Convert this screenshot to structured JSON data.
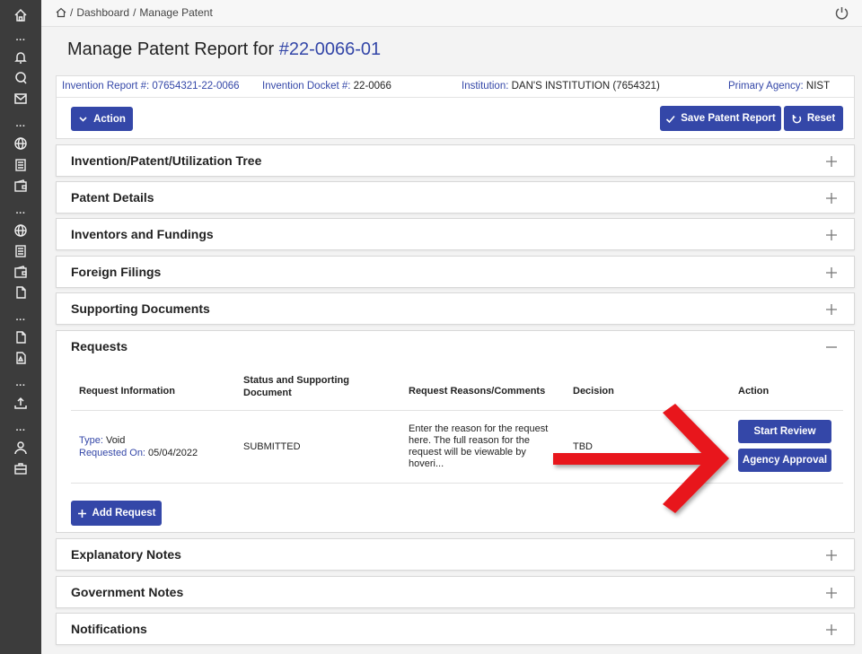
{
  "breadcrumb": {
    "home_icon": "home-icon",
    "sep": "/",
    "dashboard": "Dashboard",
    "current": "Manage Patent"
  },
  "page": {
    "title_prefix": "Manage Patent Report for ",
    "report_number": "#22-0066-01"
  },
  "info": {
    "invention_report_label": "Invention Report #:",
    "invention_report_value": " 07654321-22-0066",
    "docket_label": "Invention Docket #:",
    "docket_value": " 22-0066",
    "institution_label": "Institution:",
    "institution_value": " DAN'S INSTITUTION (7654321)",
    "agency_label": "Primary Agency:",
    "agency_value": " NIST"
  },
  "toolbar": {
    "action_label": "Action",
    "save_label": "Save Patent Report",
    "reset_label": "Reset"
  },
  "sections": {
    "tree": "Invention/Patent/Utilization Tree",
    "patent_details": "Patent Details",
    "inventors": "Inventors and Fundings",
    "foreign": "Foreign Filings",
    "supporting": "Supporting Documents",
    "requests": "Requests",
    "explanatory": "Explanatory Notes",
    "government": "Government Notes",
    "notifications": "Notifications"
  },
  "requests": {
    "columns": [
      "Request Information",
      "Status and Supporting Document",
      "Request Reasons/Comments",
      "Decision",
      "Action"
    ],
    "row": {
      "type_label": "Type:",
      "type_value": " Void",
      "requested_label": "Requested On:",
      "requested_value": " 05/04/2022",
      "status": "SUBMITTED",
      "reason": "Enter the reason for the request here. The full reason for the request will be viewable by hoveri...",
      "decision": "TBD",
      "start_review_label": "Start Review",
      "agency_approval_label": "Agency Approval"
    },
    "add_request_label": "Add Request"
  },
  "colors": {
    "accent": "#3447a8",
    "sidebar": "#3c3c3c",
    "annotation_arrow": "#e8141b"
  }
}
